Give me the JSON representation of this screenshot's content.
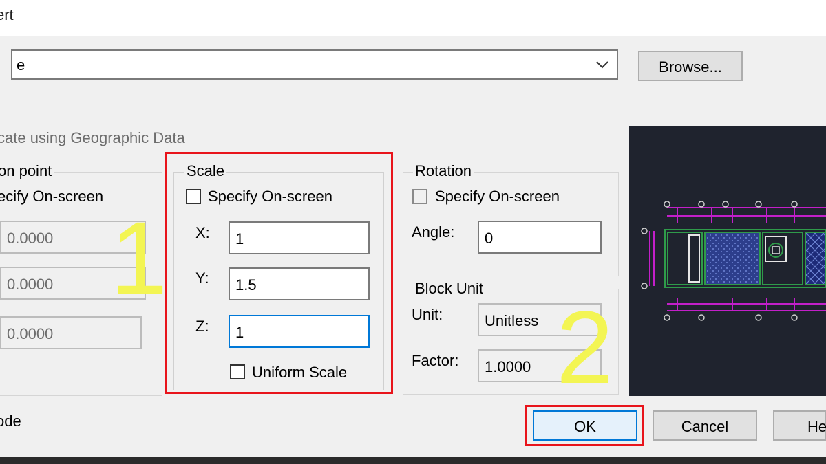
{
  "window": {
    "title": "ert"
  },
  "name_combo": {
    "value": "e"
  },
  "buttons": {
    "browse": "Browse...",
    "ok": "OK",
    "cancel": "Cancel",
    "help": "He"
  },
  "geo_label": "cate using Geographic Data",
  "insertion_point": {
    "title": "on point",
    "specify": "ecify On-screen",
    "x": "0.0000",
    "y": "0.0000",
    "z": "0.0000"
  },
  "scale": {
    "title": "Scale",
    "specify": "Specify On-screen",
    "x_label": "X:",
    "y_label": "Y:",
    "z_label": "Z:",
    "x": "1",
    "y": "1.5",
    "z": "1",
    "uniform": "Uniform Scale"
  },
  "rotation": {
    "title": "Rotation",
    "specify": "Specify On-screen",
    "angle_label": "Angle:",
    "angle": "0"
  },
  "block_unit": {
    "title": "Block Unit",
    "unit_label": "Unit:",
    "unit": "Unitless",
    "factor_label": "Factor:",
    "factor": "1.0000"
  },
  "bottom_label": "ode",
  "annotations": {
    "step1": "1",
    "step2": "2"
  },
  "colors": {
    "highlight": "#e8141b",
    "annotation": "#f3f553",
    "focus": "#0078d7",
    "preview_bg": "#1f232e"
  },
  "icons": [
    "chevron-down-icon",
    "checkbox-icon"
  ]
}
